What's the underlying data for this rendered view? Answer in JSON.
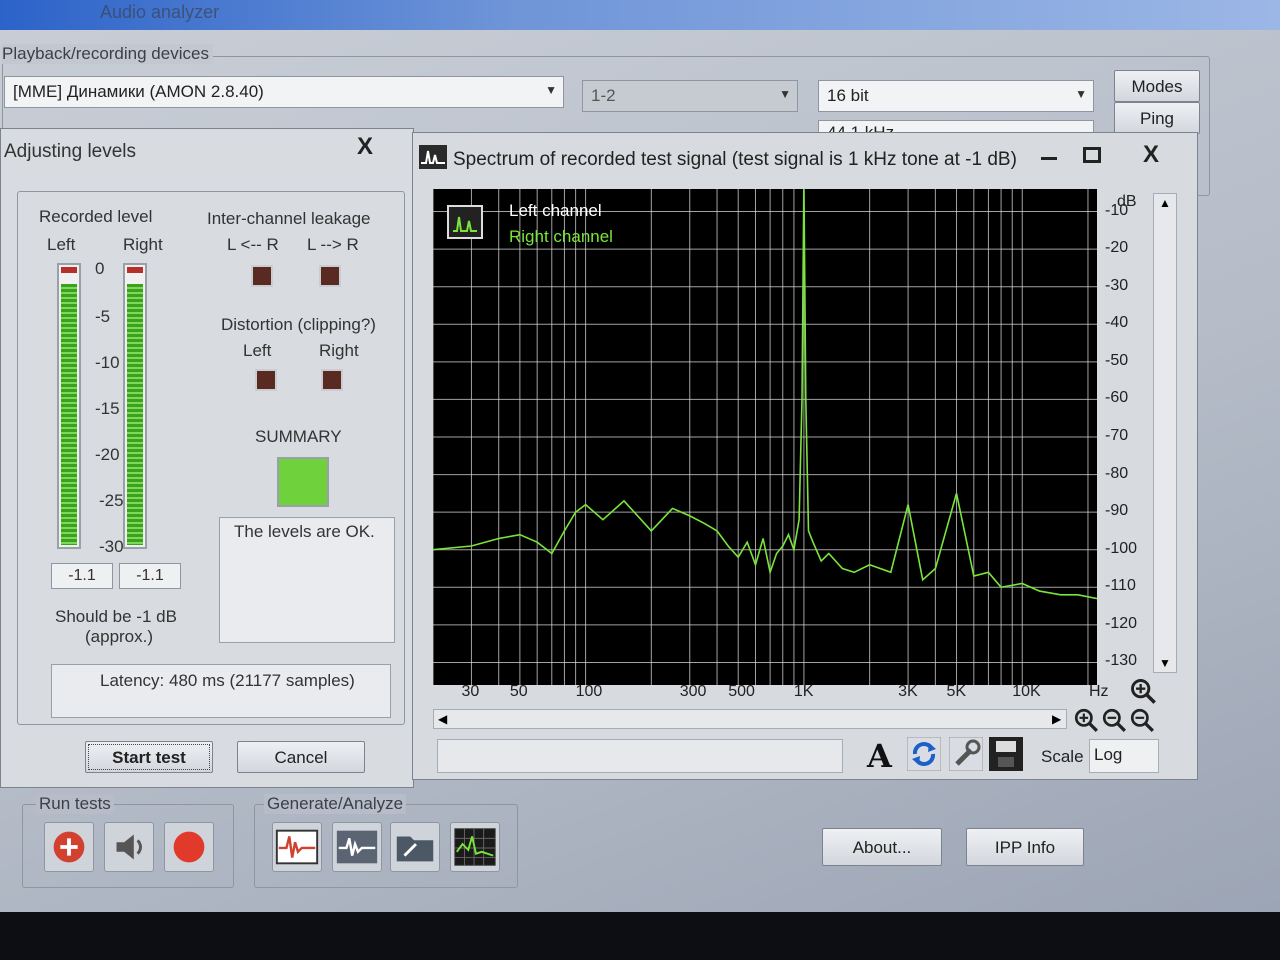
{
  "app": {
    "title": "Audio analyzer"
  },
  "devices": {
    "group_label": "Playback/recording devices",
    "device": "[MME] Динамики (AMON 2.8.40)",
    "channels": "1-2",
    "bits": "16 bit",
    "rate_partial": "44.1 kHz",
    "modes_label": "Modes",
    "ping_label": "Ping"
  },
  "adjust": {
    "title": "Adjusting levels",
    "close_glyph": "X",
    "recorded_level": "Recorded level",
    "left": "Left",
    "right": "Right",
    "meter_scale": [
      "0",
      "-5",
      "-10",
      "-15",
      "-20",
      "-25",
      "-30"
    ],
    "left_level": 0.96,
    "right_level": 0.96,
    "left_value": "-1.1",
    "right_value": "-1.1",
    "should_be": "Should be  -1 dB",
    "approx": "(approx.)",
    "leakage_label": "Inter-channel leakage",
    "leak_lr": "L <-- R",
    "leak_rl": "L --> R",
    "distortion_label": "Distortion (clipping?)",
    "dist_left": "Left",
    "dist_right": "Right",
    "summary_label": "SUMMARY",
    "message": "The levels are OK.",
    "latency": "Latency: 480 ms (21177 samples)",
    "start_label": "Start test",
    "cancel_label": "Cancel"
  },
  "spectrum": {
    "title": "Spectrum of recorded test signal (test signal is 1 kHz tone at -1 dB)",
    "legend_left": "Left channel",
    "legend_right": "Right channel",
    "db_unit": "dB",
    "db_ticks": [
      "-10",
      "-20",
      "-30",
      "-40",
      "-50",
      "-60",
      "-70",
      "-80",
      "-90",
      "-100",
      "-110",
      "-120",
      "-130"
    ],
    "hz_ticks": [
      "30",
      "50",
      "100",
      "300",
      "500",
      "1K",
      "3K",
      "5K",
      "10K"
    ],
    "hz_unit": "Hz",
    "scale_label": "Scale",
    "scale_value": "Log",
    "font_glyph": "A",
    "colors": {
      "trace": "#7ae43a",
      "grid": "#d8d8d8",
      "legend_left": "#ffffff",
      "legend_right": "#7ae43a"
    }
  },
  "chart_data": {
    "type": "line",
    "title": "Spectrum of recorded test signal (test signal is 1 kHz tone at -1 dB)",
    "xlabel": "Hz",
    "ylabel": "dB",
    "xscale": "log",
    "xlim": [
      20,
      22000
    ],
    "ylim": [
      -136,
      -4
    ],
    "grid": true,
    "legend": [
      "Left channel",
      "Right channel"
    ],
    "series": [
      {
        "name": "Right channel",
        "x": [
          20,
          30,
          40,
          50,
          60,
          70,
          80,
          90,
          100,
          120,
          150,
          200,
          250,
          300,
          350,
          400,
          450,
          500,
          550,
          600,
          650,
          700,
          750,
          800,
          850,
          900,
          950,
          980,
          1000,
          1020,
          1050,
          1100,
          1200,
          1300,
          1500,
          1700,
          2000,
          2500,
          3000,
          3500,
          4000,
          5000,
          6000,
          7000,
          8000,
          10000,
          12000,
          15000,
          18000,
          22000
        ],
        "y": [
          -100,
          -99,
          -97,
          -96,
          -98,
          -101,
          -95,
          -90,
          -88,
          -92,
          -87,
          -95,
          -89,
          -91,
          -93,
          -95,
          -99,
          -102,
          -98,
          -104,
          -97,
          -106,
          -101,
          -99,
          -96,
          -100,
          -92,
          -60,
          -2,
          -60,
          -95,
          -98,
          -103,
          -101,
          -105,
          -106,
          -104,
          -106,
          -88,
          -108,
          -105,
          -85,
          -107,
          -106,
          -110,
          -109,
          -111,
          -112,
          -112,
          -113
        ]
      }
    ]
  },
  "run_tests": {
    "label": "Run tests"
  },
  "generate": {
    "label": "Generate/Analyze"
  },
  "about_label": "About...",
  "ipp_label": "IPP Info"
}
